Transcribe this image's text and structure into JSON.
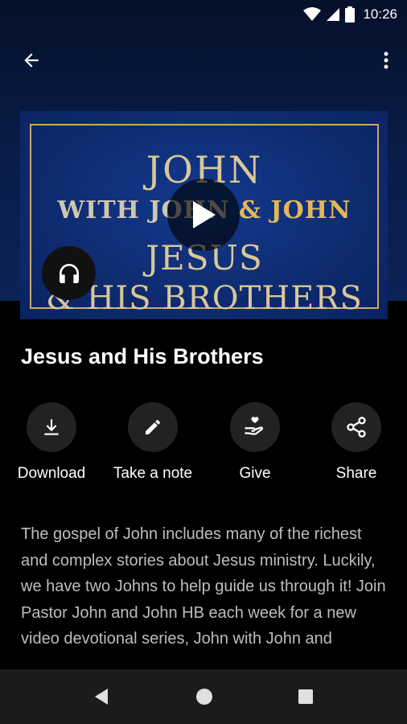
{
  "status_bar": {
    "time": "10:26"
  },
  "thumbnail": {
    "line1": "JOHN",
    "line2_a": "WITH JOHN",
    "line2_b": " & JOHN",
    "line3": "JESUS",
    "line4": "& HIS BROTHERS"
  },
  "title": "Jesus and His Brothers",
  "actions": [
    {
      "label": "Download",
      "icon": "download-icon"
    },
    {
      "label": "Take a note",
      "icon": "pencil-icon"
    },
    {
      "label": "Give",
      "icon": "give-icon"
    },
    {
      "label": "Share",
      "icon": "share-icon"
    }
  ],
  "description": "The gospel of John includes many of the richest and complex stories about Jesus ministry. Luckily, we have two Johns to help guide us through it! Join Pastor John and John HB each week for a new video devotional series, John with John and",
  "colors": {
    "accent_gold": "#c9a86a",
    "hero_blue": "#0c2356",
    "background": "#000000"
  }
}
